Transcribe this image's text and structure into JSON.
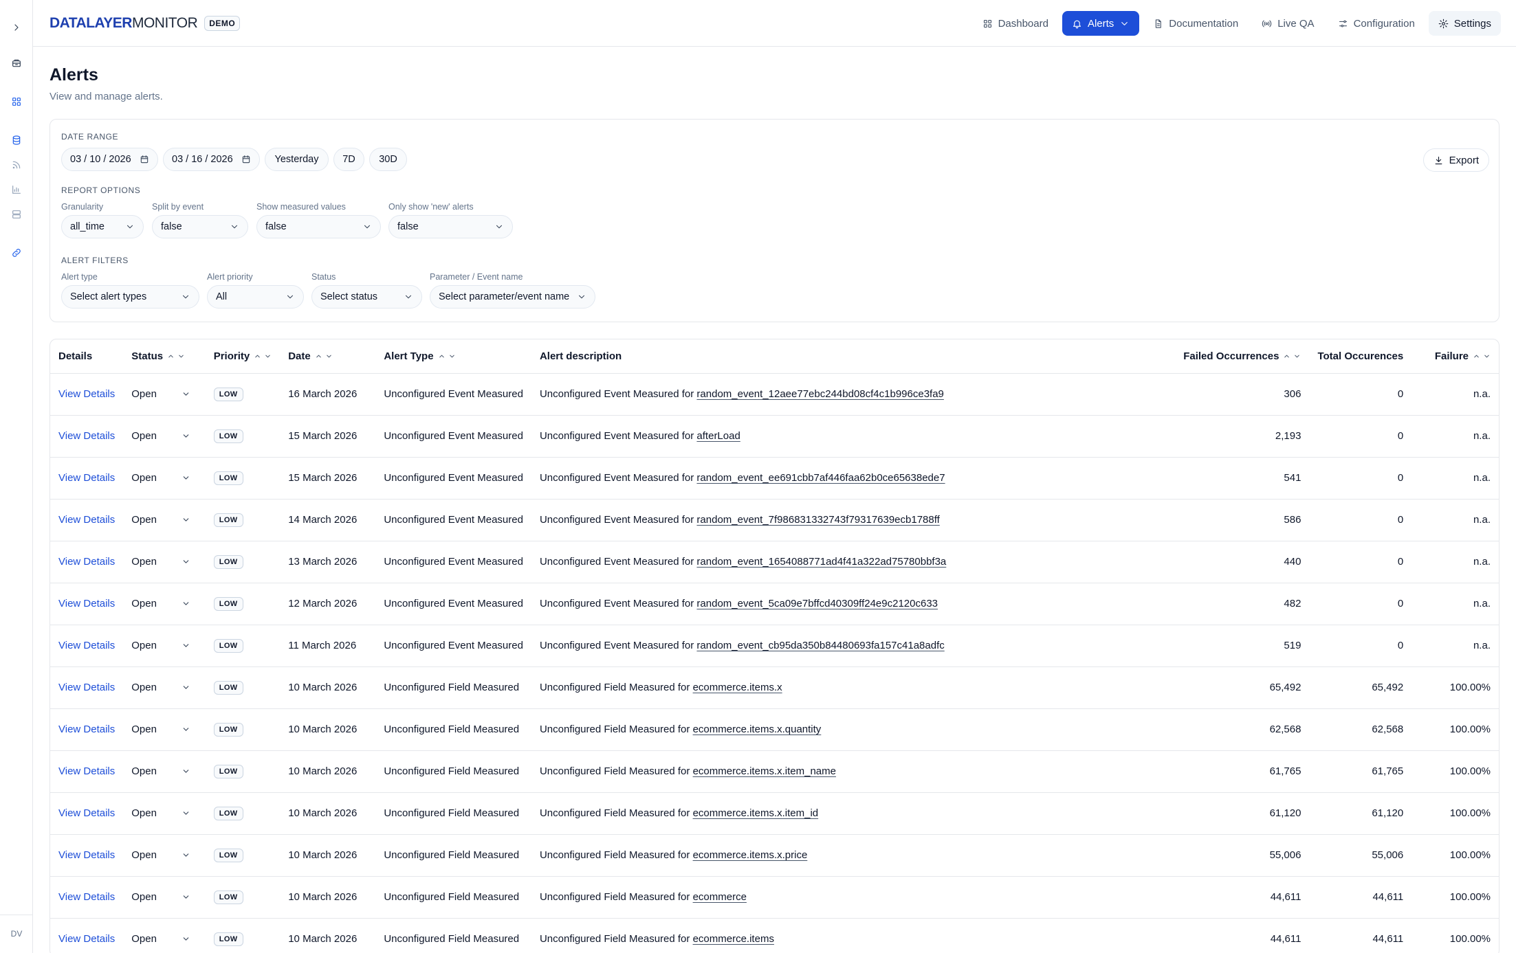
{
  "brand": {
    "bold": "DATALAYER",
    "regular": "MONITOR",
    "badge": "DEMO"
  },
  "nav": [
    {
      "label": "Dashboard",
      "icon": "dashboard-icon"
    },
    {
      "label": "Alerts",
      "icon": "bell-icon",
      "active": true
    },
    {
      "label": "Documentation",
      "icon": "document-icon"
    },
    {
      "label": "Live QA",
      "icon": "broadcast-icon"
    },
    {
      "label": "Configuration",
      "icon": "sliders-icon"
    },
    {
      "label": "Settings",
      "icon": "gear-icon"
    }
  ],
  "sidebar": {
    "avatar": "DV"
  },
  "page": {
    "title": "Alerts",
    "subtitle": "View and manage alerts."
  },
  "filters": {
    "date_range_label": "DATE RANGE",
    "start_date": "03 / 10 / 2026",
    "end_date": "03 / 16 / 2026",
    "quick_ranges": [
      "Yesterday",
      "7D",
      "30D"
    ],
    "export_label": "Export",
    "report_options_label": "REPORT OPTIONS",
    "granularity": {
      "label": "Granularity",
      "value": "all_time"
    },
    "split_by_event": {
      "label": "Split by event",
      "value": "false"
    },
    "show_measured": {
      "label": "Show measured values",
      "value": "false"
    },
    "only_new": {
      "label": "Only show 'new' alerts",
      "value": "false"
    },
    "alert_filters_label": "ALERT FILTERS",
    "alert_type": {
      "label": "Alert type",
      "value": "Select alert types"
    },
    "alert_priority": {
      "label": "Alert priority",
      "value": "All"
    },
    "status": {
      "label": "Status",
      "value": "Select status"
    },
    "param_event": {
      "label": "Parameter / Event name",
      "value": "Select parameter/event name"
    }
  },
  "table": {
    "columns": [
      "Details",
      "Status",
      "Priority",
      "Date",
      "Alert Type",
      "Alert description",
      "Failed Occurrences",
      "Total Occurences",
      "Failure"
    ],
    "rows": [
      {
        "details": "View Details",
        "status": "Open",
        "priority": "LOW",
        "date": "16 March 2026",
        "type": "Unconfigured Event Measured",
        "desc_prefix": "Unconfigured Event Measured for",
        "desc_target": "random_event_12aee77ebc244bd08cf4c1b996ce3fa9",
        "failed": "306",
        "total": "0",
        "failure": "n.a."
      },
      {
        "details": "View Details",
        "status": "Open",
        "priority": "LOW",
        "date": "15 March 2026",
        "type": "Unconfigured Event Measured",
        "desc_prefix": "Unconfigured Event Measured for",
        "desc_target": "afterLoad",
        "failed": "2,193",
        "total": "0",
        "failure": "n.a."
      },
      {
        "details": "View Details",
        "status": "Open",
        "priority": "LOW",
        "date": "15 March 2026",
        "type": "Unconfigured Event Measured",
        "desc_prefix": "Unconfigured Event Measured for",
        "desc_target": "random_event_ee691cbb7af446faa62b0ce65638ede7",
        "failed": "541",
        "total": "0",
        "failure": "n.a."
      },
      {
        "details": "View Details",
        "status": "Open",
        "priority": "LOW",
        "date": "14 March 2026",
        "type": "Unconfigured Event Measured",
        "desc_prefix": "Unconfigured Event Measured for",
        "desc_target": "random_event_7f986831332743f79317639ecb1788ff",
        "failed": "586",
        "total": "0",
        "failure": "n.a."
      },
      {
        "details": "View Details",
        "status": "Open",
        "priority": "LOW",
        "date": "13 March 2026",
        "type": "Unconfigured Event Measured",
        "desc_prefix": "Unconfigured Event Measured for",
        "desc_target": "random_event_1654088771ad4f41a322ad75780bbf3a",
        "failed": "440",
        "total": "0",
        "failure": "n.a."
      },
      {
        "details": "View Details",
        "status": "Open",
        "priority": "LOW",
        "date": "12 March 2026",
        "type": "Unconfigured Event Measured",
        "desc_prefix": "Unconfigured Event Measured for",
        "desc_target": "random_event_5ca09e7bffcd40309ff24e9c2120c633",
        "failed": "482",
        "total": "0",
        "failure": "n.a."
      },
      {
        "details": "View Details",
        "status": "Open",
        "priority": "LOW",
        "date": "11 March 2026",
        "type": "Unconfigured Event Measured",
        "desc_prefix": "Unconfigured Event Measured for",
        "desc_target": "random_event_cb95da350b84480693fa157c41a8adfc",
        "failed": "519",
        "total": "0",
        "failure": "n.a."
      },
      {
        "details": "View Details",
        "status": "Open",
        "priority": "LOW",
        "date": "10 March 2026",
        "type": "Unconfigured Field Measured",
        "desc_prefix": "Unconfigured Field Measured for",
        "desc_target": "ecommerce.items.x",
        "failed": "65,492",
        "total": "65,492",
        "failure": "100.00%"
      },
      {
        "details": "View Details",
        "status": "Open",
        "priority": "LOW",
        "date": "10 March 2026",
        "type": "Unconfigured Field Measured",
        "desc_prefix": "Unconfigured Field Measured for",
        "desc_target": "ecommerce.items.x.quantity",
        "failed": "62,568",
        "total": "62,568",
        "failure": "100.00%"
      },
      {
        "details": "View Details",
        "status": "Open",
        "priority": "LOW",
        "date": "10 March 2026",
        "type": "Unconfigured Field Measured",
        "desc_prefix": "Unconfigured Field Measured for",
        "desc_target": "ecommerce.items.x.item_name",
        "failed": "61,765",
        "total": "61,765",
        "failure": "100.00%"
      },
      {
        "details": "View Details",
        "status": "Open",
        "priority": "LOW",
        "date": "10 March 2026",
        "type": "Unconfigured Field Measured",
        "desc_prefix": "Unconfigured Field Measured for",
        "desc_target": "ecommerce.items.x.item_id",
        "failed": "61,120",
        "total": "61,120",
        "failure": "100.00%"
      },
      {
        "details": "View Details",
        "status": "Open",
        "priority": "LOW",
        "date": "10 March 2026",
        "type": "Unconfigured Field Measured",
        "desc_prefix": "Unconfigured Field Measured for",
        "desc_target": "ecommerce.items.x.price",
        "failed": "55,006",
        "total": "55,006",
        "failure": "100.00%"
      },
      {
        "details": "View Details",
        "status": "Open",
        "priority": "LOW",
        "date": "10 March 2026",
        "type": "Unconfigured Field Measured",
        "desc_prefix": "Unconfigured Field Measured for",
        "desc_target": "ecommerce",
        "failed": "44,611",
        "total": "44,611",
        "failure": "100.00%"
      },
      {
        "details": "View Details",
        "status": "Open",
        "priority": "LOW",
        "date": "10 March 2026",
        "type": "Unconfigured Field Measured",
        "desc_prefix": "Unconfigured Field Measured for",
        "desc_target": "ecommerce.items",
        "failed": "44,611",
        "total": "44,611",
        "failure": "100.00%"
      }
    ]
  },
  "colors": {
    "accent": "#1d4ed8",
    "border": "#e5e7eb",
    "muted_text": "#64748b"
  }
}
